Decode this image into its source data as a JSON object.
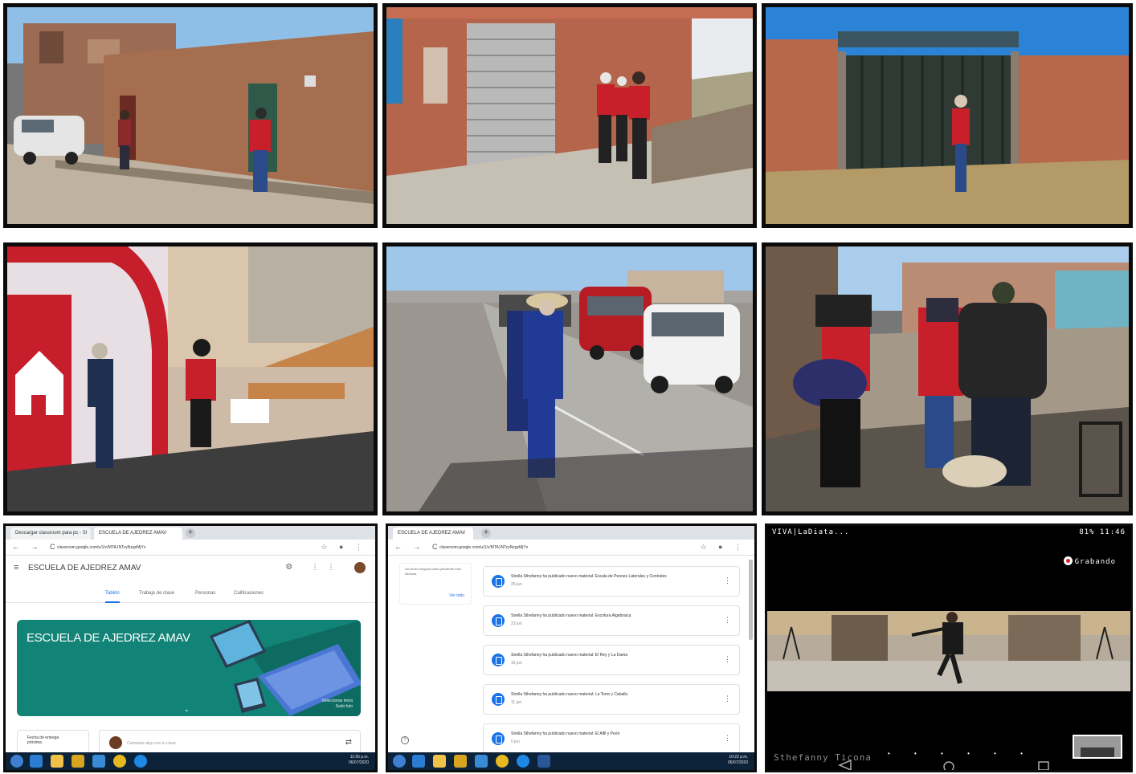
{
  "tiles": {
    "t7": {
      "tabs": [
        "Descargar classroom para pc - Sl",
        "ESCUELA DE AJEDREZ AMAV"
      ],
      "url": "classroom.google.com/u/1/c/MTA1NTcyNzgzMjYx",
      "class_name": "ESCUELA DE AJEDREZ AMAV",
      "nav_tabs": [
        "Tablón",
        "Trabajo de clase",
        "Personas",
        "Calificaciones"
      ],
      "banner_title": "ESCUELA DE AJEDREZ AMAV",
      "banner_link": "Seleccionar tema\nSubir foto",
      "due_label": "Fecha de entrega\npróxima",
      "share_placeholder": "Comparte algo con tu clase",
      "clock": "11:56 p.m.\n06/07/2020"
    },
    "t8": {
      "tabs": [
        "ESCUELA DE AJEDREZ AMAV"
      ],
      "url": "classroom.google.com/u/1/c/MTA1NTcyNzgzMjYx",
      "side_text": "No tienes ninguna tarea pendiente esta semana",
      "side_button": "Ver todo",
      "posts": [
        {
          "title": "Strella Sthefanny ha publicado nuevo material: Escala de Peones Laterales y Centrales",
          "date": "25 jun"
        },
        {
          "title": "Strella Sthefanny ha publicado nuevo material: Escritura Algebraica",
          "date": "23 jun"
        },
        {
          "title": "Strella Sthefanny ha publicado nuevo material: El Rey y La Dama",
          "date": "16 jun"
        },
        {
          "title": "Strella Sthefanny ha publicado nuevo material: La Torre y Caballo",
          "date": "11 jun"
        },
        {
          "title": "Strella Sthefanny ha publicado nuevo material: El Alfil y Peón",
          "date": "5 jun"
        }
      ],
      "clock": "10:22 p.m.\n06/07/2020"
    },
    "t9": {
      "status_left": "VIVA|LaDiata...",
      "status_right": "81%  11:46",
      "recording": "Grabando",
      "name": "Sthefanny Ticona"
    }
  },
  "colors": {
    "tile_border": "#0b0b0b",
    "classroom_teal": "#128377",
    "google_blue": "#1a73e8",
    "vest_red": "#c8202a",
    "taskbar": "#0c2238"
  }
}
